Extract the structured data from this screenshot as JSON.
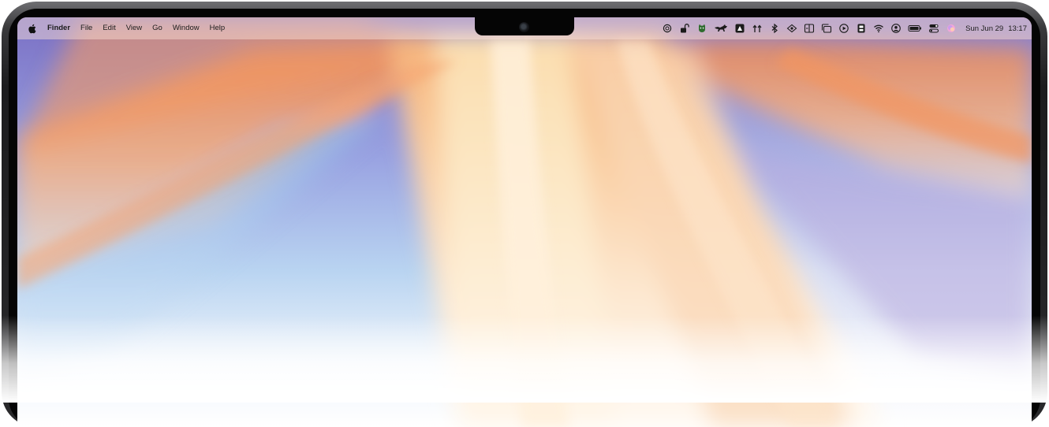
{
  "menubar": {
    "app_name": "Finder",
    "menus": [
      "File",
      "Edit",
      "View",
      "Go",
      "Window",
      "Help"
    ],
    "status_icons": [
      "chatgpt-icon",
      "unlock-icon",
      "cat-icon",
      "running-cat-icon",
      "dropzone-icon",
      "airdrop-share-icon",
      "bluetooth-icon",
      "eye-code-icon",
      "window-split-icon",
      "stage-manager-icon",
      "play-icon",
      "sidebar-app-icon",
      "wifi-icon",
      "user-icon",
      "battery-icon",
      "control-center-icon",
      "siri-icon"
    ],
    "clock": {
      "date": "Sun Jun 29",
      "time": "13:17"
    }
  },
  "colors": {
    "wallpaper_orange": "#f79a5e",
    "wallpaper_blue": "#7fa8df",
    "wallpaper_cream": "#fbe0bf",
    "wallpaper_purple": "#8f7fc4",
    "bezel": "#1c1c1e"
  }
}
